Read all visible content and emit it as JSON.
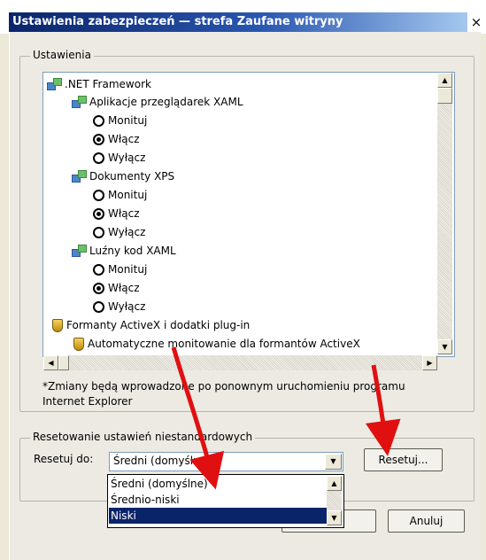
{
  "window": {
    "title": "Ustawienia zabezpieczeń — strefa Zaufane witryny",
    "close_glyph": "×"
  },
  "settings_group": {
    "label": "Ustawienia",
    "tree": [
      {
        "text": ".NET Framework"
      },
      {
        "text": "Aplikacje przeglądarek XAML"
      },
      {
        "text": "Monituj"
      },
      {
        "text": "Włącz"
      },
      {
        "text": "Wyłącz"
      },
      {
        "text": "Dokumenty XPS"
      },
      {
        "text": "Monituj"
      },
      {
        "text": "Włącz"
      },
      {
        "text": "Wyłącz"
      },
      {
        "text": "Luźny kod XAML"
      },
      {
        "text": "Monituj"
      },
      {
        "text": "Włącz"
      },
      {
        "text": "Wyłącz"
      },
      {
        "text": "Formanty ActiveX i dodatki plug-in"
      },
      {
        "text": "Automatyczne monitowanie dla formantów ActiveX"
      }
    ],
    "note": "*Zmiany będą wprowadzone po ponownym uruchomieniu programu Internet Explorer"
  },
  "reset_group": {
    "label": "Resetowanie ustawień niestandardowych",
    "reset_to_label": "Resetuj do:",
    "selected": "Średni (domyślne)",
    "options": [
      "Średni (domyślne)",
      "Średnio-niski",
      "Niski"
    ],
    "highlighted": "Niski",
    "reset_button": "Resetuj..."
  },
  "footer": {
    "cancel_button": "Anuluj"
  },
  "colors": {
    "titlebar": "#0a246a",
    "selection": "#0a246a",
    "annotation_arrow": "#e01010"
  }
}
